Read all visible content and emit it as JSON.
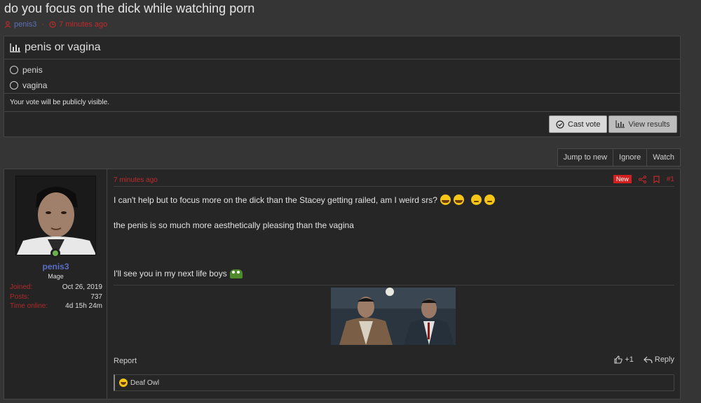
{
  "thread": {
    "title": "do you focus on the dick while watching porn",
    "author": "penis3",
    "time": "7 minutes ago"
  },
  "poll": {
    "question": "penis or vagina",
    "options": [
      "penis",
      "vagina"
    ],
    "note": "Your vote will be publicly visible.",
    "cast_vote_label": "Cast vote",
    "view_results_label": "View results"
  },
  "thread_actions": {
    "jump_label": "Jump to new",
    "ignore_label": "Ignore",
    "watch_label": "Watch"
  },
  "post": {
    "time": "7 minutes ago",
    "badge": "New",
    "number": "#1",
    "user": {
      "name": "penis3",
      "title": "Mage",
      "stats": [
        {
          "key": "Joined:",
          "value": "Oct 26, 2019"
        },
        {
          "key": "Posts:",
          "value": "737"
        },
        {
          "key": "Time online:",
          "value": "4d 15h 24m"
        }
      ]
    },
    "paragraphs": [
      "I can't help but to focus more on the dick than the Stacey getting railed, am I weird srs?",
      "the penis is so much more aesthetically pleasing than the vagina",
      "I'll see you in my next life boys"
    ],
    "report_label": "Report",
    "like_label": "+1",
    "reply_label": "Reply",
    "reaction_user": "Deaf Owl"
  },
  "colors": {
    "accent_red": "#c02a2a",
    "username_blue": "#5a6fc4",
    "online_green": "#6ab04c"
  }
}
